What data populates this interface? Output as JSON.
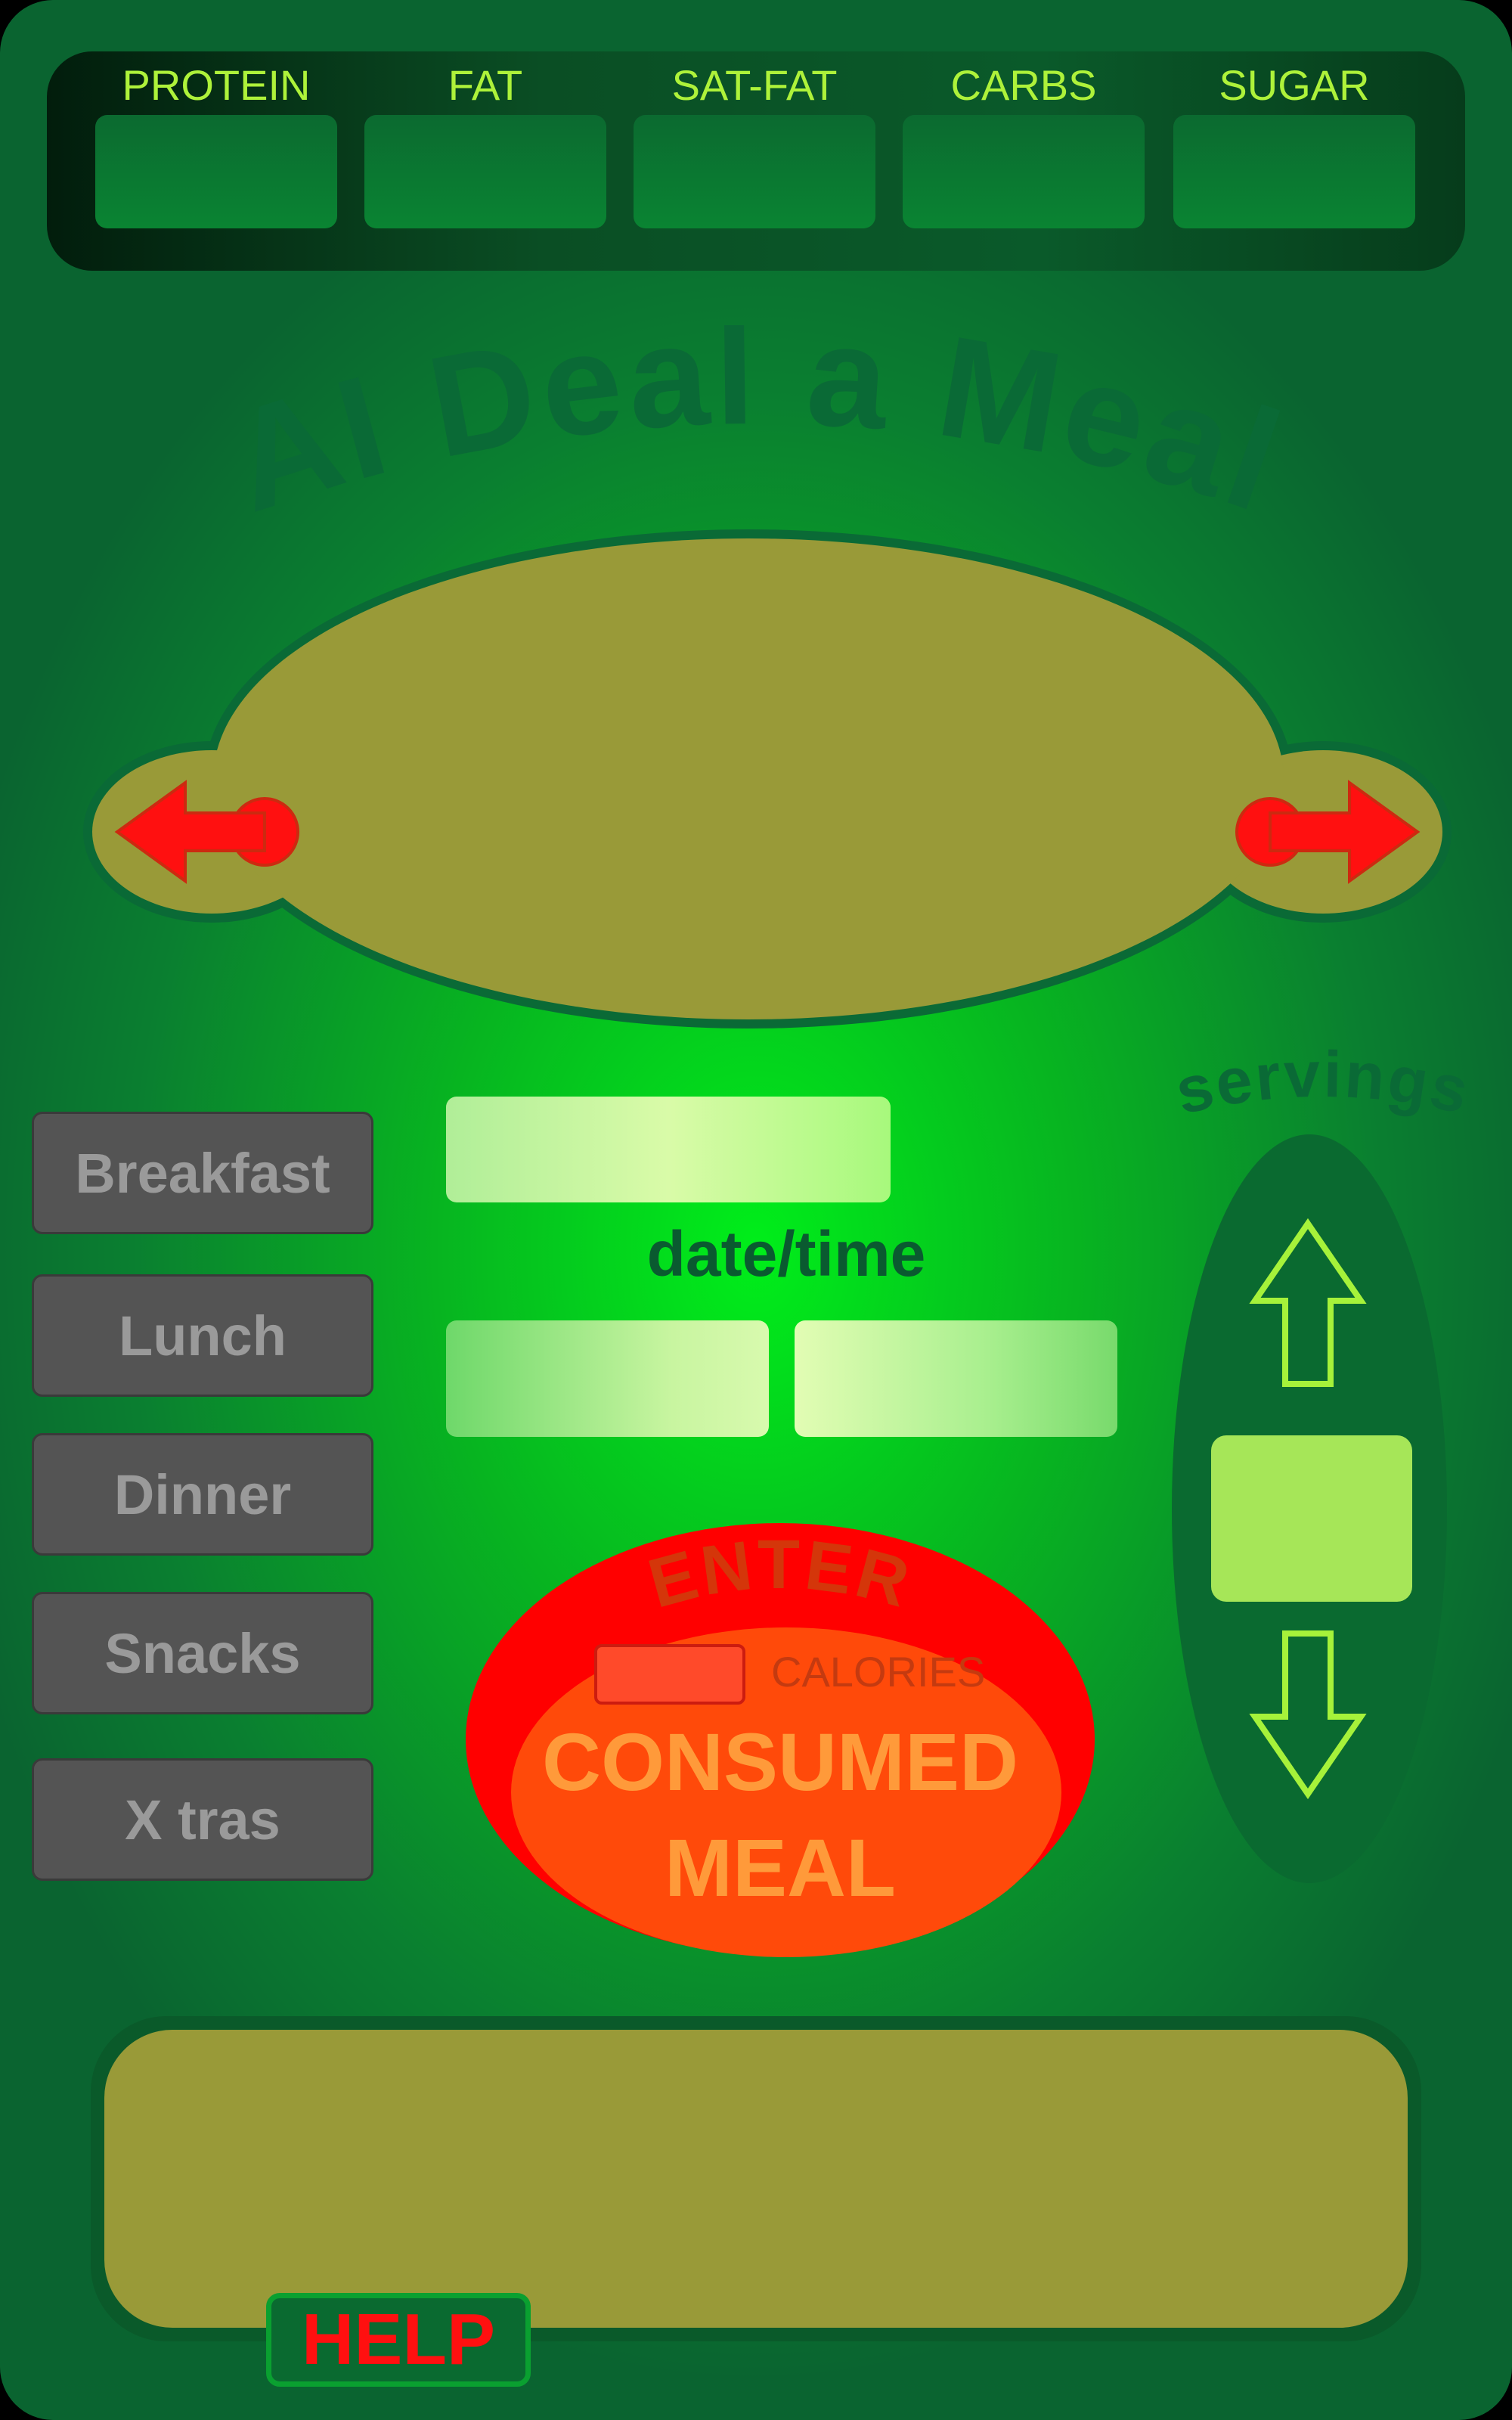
{
  "nutrients": {
    "labels": [
      "PROTEIN",
      "FAT",
      "SAT-FAT",
      "CARBS",
      "SUGAR"
    ],
    "values": [
      "",
      "",
      "",
      "",
      ""
    ]
  },
  "title": "AI Deal a Meal",
  "dish": {
    "name": "",
    "prev_icon": "arrow-left-icon",
    "next_icon": "arrow-right-icon"
  },
  "meal_types": [
    "Breakfast",
    "Lunch",
    "Dinner",
    "Snacks",
    "X tras"
  ],
  "meal_entry": {
    "meal_name_value": "",
    "date_value": "",
    "time_value": "",
    "datetime_label": "date/time"
  },
  "enter_button": {
    "top_label": "ENTER",
    "calories_label": "CALORIES",
    "calories_value": "",
    "line1": "CONSUMED",
    "line2": "MEAL"
  },
  "servings": {
    "label": "servings",
    "value": "",
    "up_icon": "arrow-up-icon",
    "down_icon": "arrow-down-icon"
  },
  "output": {
    "text": ""
  },
  "help_label": "HELP",
  "colors": {
    "background_center": "#00ee1a",
    "background_edge": "#0a6430",
    "nutrient_label": "#aef23a",
    "olive_panel": "#999a38",
    "arrow_red": "#ff1010",
    "enter_red": "#ff0000",
    "consumed_orange": "#ff5a10",
    "meal_button_gray": "#545454",
    "servings_box": "#a6e658"
  }
}
